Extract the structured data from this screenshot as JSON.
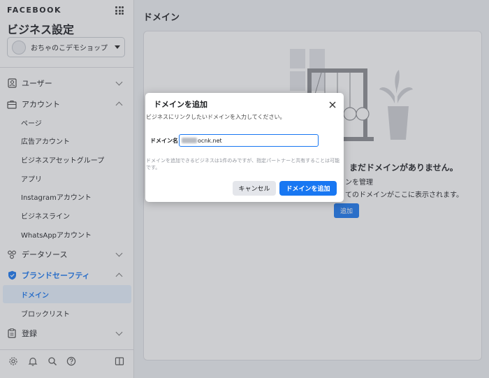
{
  "sidebar": {
    "brand": "FACEBOOK",
    "title": "ビジネス設定",
    "account": {
      "name": "おちゃのこデモショップ"
    },
    "sections": {
      "users": {
        "label": "ユーザー",
        "icon": "user-badge-icon"
      },
      "accounts": {
        "label": "アカウント",
        "icon": "briefcase-icon",
        "items": [
          "ページ",
          "広告アカウント",
          "ビジネスアセットグループ",
          "アプリ",
          "Instagramアカウント",
          "ビジネスライン",
          "WhatsAppアカウント"
        ]
      },
      "data_sources": {
        "label": "データソース",
        "icon": "people-icon"
      },
      "brand_safety": {
        "label": "ブランドセーフティ",
        "icon": "shield-icon",
        "items": [
          "ドメイン",
          "ブロックリスト"
        ]
      },
      "registration": {
        "label": "登録",
        "icon": "clipboard-icon"
      }
    },
    "footer_icons": [
      "gear-icon",
      "bell-icon",
      "search-icon",
      "help-icon",
      "sidebar-toggle-icon"
    ]
  },
  "main": {
    "title": "ドメイン",
    "empty_title": "まだドメインがありません。",
    "empty_sub1": "ンを管理",
    "empty_sub2": "てのドメインがここに表示されます。",
    "add_button": "追加"
  },
  "modal": {
    "title": "ドメインを追加",
    "description": "ビジネスにリンクしたいドメインを入力してください。",
    "field_label": "ドメイン名",
    "field_value": "ocnk.net",
    "note": "ドメインを追加できるビジネスは1件のみですが、指定パートナーと共有することは可能です。",
    "cancel_label": "キャンセル",
    "submit_label": "ドメインを追加"
  },
  "colors": {
    "accent": "#1877f2",
    "overlay": "rgba(90,94,102,0.30)"
  }
}
